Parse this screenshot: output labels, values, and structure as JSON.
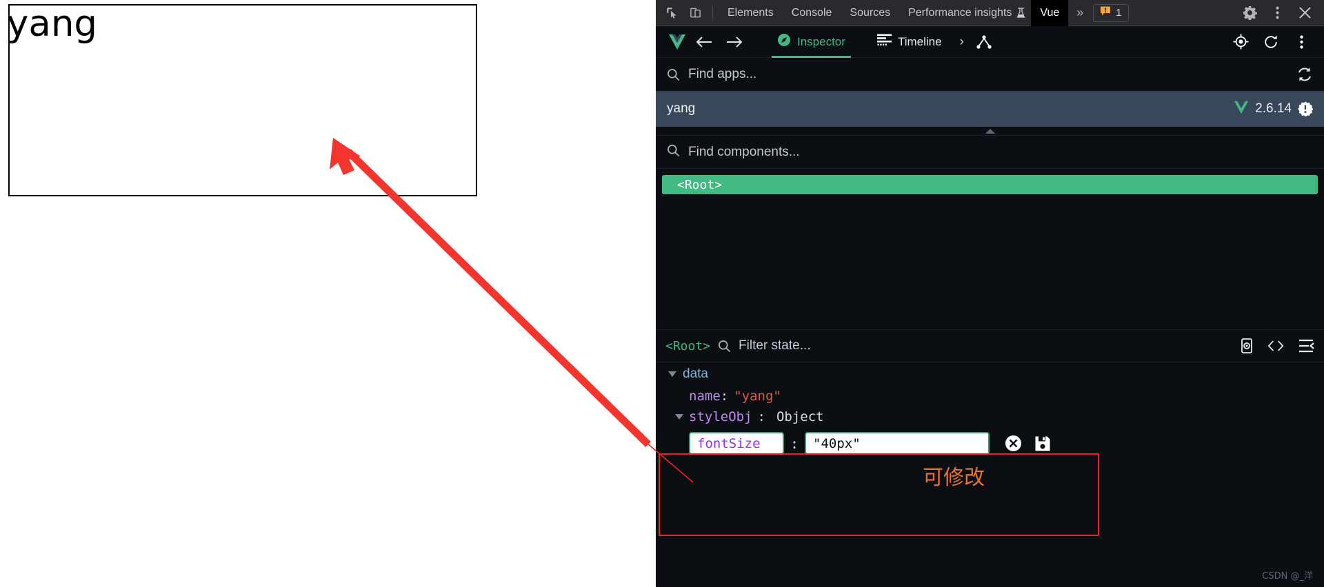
{
  "page": {
    "app_output_text": "yang",
    "annotation_note": "可修改",
    "watermark": "CSDN @_洋"
  },
  "devtools_topbar": {
    "icons": [
      {
        "name": "inspect-element-icon",
        "glyph": "inspect"
      },
      {
        "name": "device-toolbar-icon",
        "glyph": "device"
      }
    ],
    "tabs": [
      {
        "label": "Elements",
        "active": false
      },
      {
        "label": "Console",
        "active": false
      },
      {
        "label": "Sources",
        "active": false
      },
      {
        "label": "Performance insights",
        "active": false,
        "flask": true
      },
      {
        "label": "Vue",
        "active": true
      }
    ],
    "more_tabs_label": "»",
    "issues": {
      "count": "1",
      "icon": "warning-message-icon"
    },
    "right_icons": [
      {
        "name": "settings-gear-icon"
      },
      {
        "name": "more-options-icon"
      },
      {
        "name": "close-devtools-icon"
      }
    ]
  },
  "vue_toolbar": {
    "logo_name": "vue-logo-icon",
    "back_label": "←",
    "forward_label": "→",
    "tabs": [
      {
        "label": "Inspector",
        "icon": "compass-icon",
        "active": true
      },
      {
        "label": "Timeline",
        "icon": "timeline-icon",
        "active": false
      }
    ],
    "more_label": "›",
    "right_icons": [
      {
        "name": "component-tree-icon"
      },
      {
        "name": "target-select-icon"
      },
      {
        "name": "refresh-icon"
      },
      {
        "name": "more-menu-icon"
      }
    ]
  },
  "apps": {
    "search_placeholder": "Find apps...",
    "refresh_icon": "refresh-apps-icon",
    "selected": {
      "name": "yang",
      "version": "2.6.14",
      "badge_icon": "warning-badge-icon"
    }
  },
  "components": {
    "search_placeholder": "Find components...",
    "tree": [
      {
        "label": "<Root>",
        "selected": true
      }
    ]
  },
  "state_panel": {
    "breadcrumb": "<Root>",
    "filter_placeholder": "Filter state...",
    "right_icons": [
      {
        "name": "inspect-dom-icon"
      },
      {
        "name": "open-in-editor-icon"
      },
      {
        "name": "expand-collapse-icon"
      }
    ],
    "groups": [
      {
        "label": "data",
        "expanded": true,
        "entries": [
          {
            "key": "name",
            "colon": ":",
            "value": "\"yang\"",
            "type": "string"
          },
          {
            "key": "styleObj",
            "colon": ":",
            "value": "Object",
            "type": "object",
            "expanded": true
          }
        ],
        "editor": {
          "key_value": "fontSize",
          "colon": ":",
          "value_value": "\"40px\"",
          "cancel_icon": "cancel-edit-icon",
          "save_icon": "save-edit-icon"
        }
      }
    ]
  },
  "colors": {
    "vue_green": "#42b983",
    "panel_bg": "#0b0f14",
    "selected_row": "#39475a",
    "annotation_red": "#ee2222",
    "annotation_orange": "#e8722c",
    "string_red": "#e0574a",
    "key_purple": "#c586f0"
  }
}
